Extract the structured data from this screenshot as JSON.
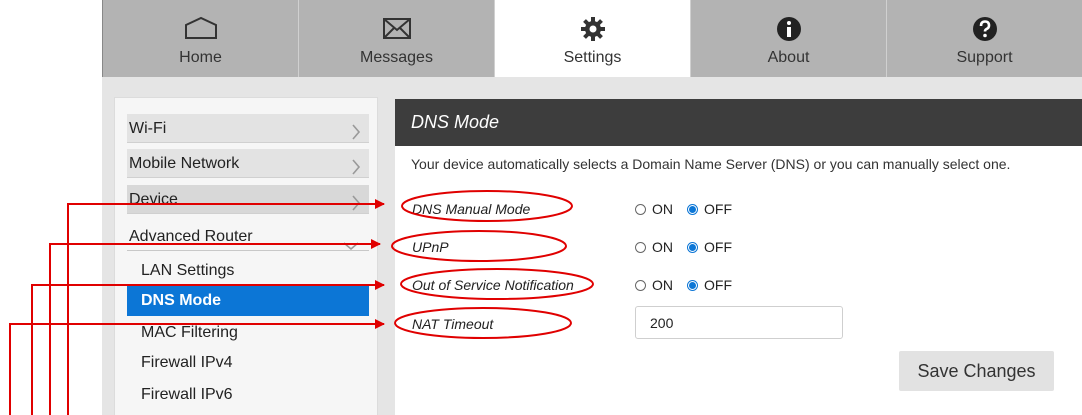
{
  "nav": {
    "tabs": [
      {
        "label": "Home",
        "icon": "home-icon",
        "active": false
      },
      {
        "label": "Messages",
        "icon": "envelope-icon",
        "active": false
      },
      {
        "label": "Settings",
        "icon": "gear-icon",
        "active": true
      },
      {
        "label": "About",
        "icon": "info-icon",
        "active": false
      },
      {
        "label": "Support",
        "icon": "question-icon",
        "active": false
      }
    ]
  },
  "sidebar": {
    "items": [
      {
        "label": "Wi-Fi"
      },
      {
        "label": "Mobile Network"
      },
      {
        "label": "Device"
      },
      {
        "label": "Advanced Router"
      }
    ],
    "subitems": [
      {
        "label": "LAN Settings",
        "active": false
      },
      {
        "label": "DNS Mode",
        "active": true
      },
      {
        "label": "MAC Filtering",
        "active": false
      },
      {
        "label": "Firewall IPv4",
        "active": false
      },
      {
        "label": "Firewall IPv6",
        "active": false
      }
    ]
  },
  "panel": {
    "title": "DNS Mode",
    "description": "Your device automatically selects a Domain Name Server (DNS) or you can manually select one.",
    "rows": [
      {
        "label": "DNS Manual Mode",
        "on_label": "ON",
        "off_label": "OFF",
        "selected": "OFF"
      },
      {
        "label": "UPnP",
        "on_label": "ON",
        "off_label": "OFF",
        "selected": "OFF"
      },
      {
        "label": "Out of Service Notification",
        "on_label": "ON",
        "off_label": "OFF",
        "selected": "OFF"
      }
    ],
    "nat_timeout": {
      "label": "NAT Timeout",
      "value": "200"
    },
    "save_label": "Save Changes"
  },
  "colors": {
    "accent": "#0c76d6",
    "header_bg": "#3d3d3d",
    "nav_bg": "#b3b3b3",
    "annotation": "#e00000"
  }
}
